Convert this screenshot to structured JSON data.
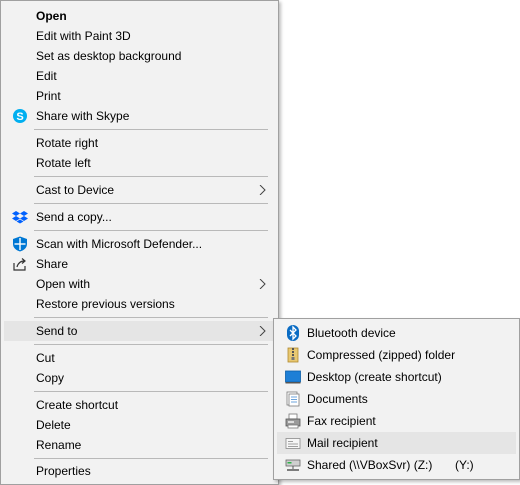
{
  "main_menu": {
    "open": "Open",
    "edit_paint3d": "Edit with Paint 3D",
    "set_background": "Set as desktop background",
    "edit": "Edit",
    "print": "Print",
    "share_skype": "Share with Skype",
    "rotate_right": "Rotate right",
    "rotate_left": "Rotate left",
    "cast_to_device": "Cast to Device",
    "send_copy": "Send a copy...",
    "scan_defender": "Scan with Microsoft Defender...",
    "share": "Share",
    "open_with": "Open with",
    "restore_versions": "Restore previous versions",
    "send_to": "Send to",
    "cut": "Cut",
    "copy": "Copy",
    "create_shortcut": "Create shortcut",
    "delete": "Delete",
    "rename": "Rename",
    "properties": "Properties"
  },
  "send_to_menu": {
    "bluetooth": "Bluetooth device",
    "compressed": "Compressed (zipped) folder",
    "desktop": "Desktop (create shortcut)",
    "documents": "Documents",
    "fax": "Fax recipient",
    "mail": "Mail recipient",
    "shared": "Shared (\\\\VBoxSvr) (Z:)",
    "shared_drive": "(Y:)"
  },
  "colors": {
    "menu_bg": "#f2f2f2",
    "highlight": "#e5e5e5",
    "separator": "#b9b9b9",
    "skype": "#00aff0",
    "dropbox": "#0061fe",
    "defender": "#0078d4",
    "bluetooth": "#0a6cc4"
  },
  "icons": {
    "skype": "skype-icon",
    "dropbox": "dropbox-icon",
    "defender": "shield-icon",
    "share": "share-icon",
    "bluetooth": "bluetooth-icon",
    "zip": "zip-folder-icon",
    "desktop": "desktop-icon",
    "documents": "documents-icon",
    "fax": "fax-icon",
    "mail": "mail-icon",
    "network_drive": "network-drive-icon"
  }
}
